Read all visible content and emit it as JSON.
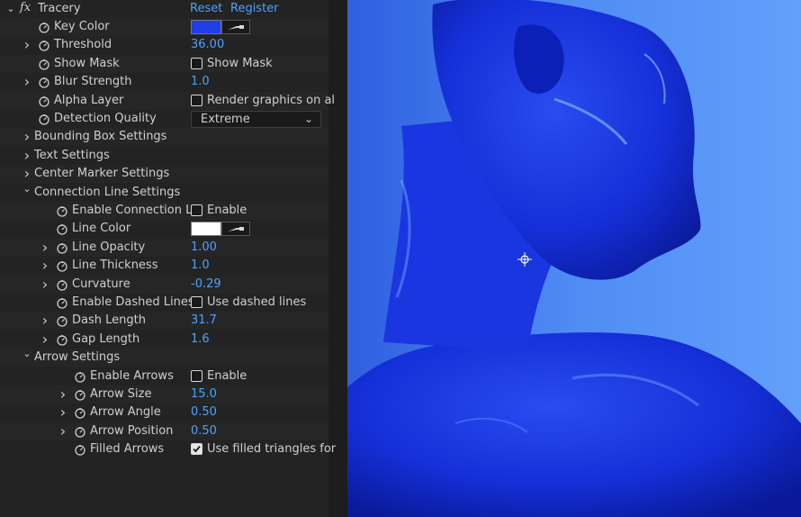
{
  "effect": {
    "name": "Tracery",
    "fx_label": "fx",
    "reset_label": "Reset",
    "register_label": "Register"
  },
  "rows": [
    {
      "label": "Key Color",
      "level": 1,
      "chevron": false,
      "stopwatch": true,
      "control": "color",
      "color": "#1e3ee6"
    },
    {
      "label": "Threshold",
      "level": 1,
      "chevron": true,
      "stopwatch": true,
      "control": "value",
      "value": "36.00"
    },
    {
      "label": "Show Mask",
      "level": 1,
      "chevron": false,
      "stopwatch": true,
      "control": "checkbox",
      "checked": false,
      "check_label": "Show Mask"
    },
    {
      "label": "Blur Strength",
      "level": 1,
      "chevron": true,
      "stopwatch": true,
      "control": "value",
      "value": "1.0"
    },
    {
      "label": "Alpha Layer",
      "level": 1,
      "chevron": false,
      "stopwatch": true,
      "control": "checkbox",
      "checked": false,
      "check_label": "Render graphics on al"
    },
    {
      "label": "Detection Quality",
      "level": 1,
      "chevron": false,
      "stopwatch": true,
      "control": "select",
      "value": "Extreme"
    },
    {
      "label": "Bounding Box Settings",
      "level": 0,
      "chevron": true,
      "stopwatch": false,
      "control": "none"
    },
    {
      "label": "Text Settings",
      "level": 0,
      "chevron": true,
      "stopwatch": false,
      "control": "none"
    },
    {
      "label": "Center Marker Settings",
      "level": 0,
      "chevron": true,
      "stopwatch": false,
      "control": "none"
    },
    {
      "label": "Connection Line Settings",
      "level": 0,
      "chevron": "open",
      "stopwatch": false,
      "control": "none"
    },
    {
      "label": "Enable Connection Li",
      "level": 2,
      "chevron": false,
      "stopwatch": true,
      "control": "checkbox",
      "checked": false,
      "check_label": "Enable"
    },
    {
      "label": "Line Color",
      "level": 2,
      "chevron": false,
      "stopwatch": true,
      "control": "color",
      "color": "#ffffff"
    },
    {
      "label": "Line Opacity",
      "level": 2,
      "chevron": true,
      "stopwatch": true,
      "control": "value",
      "value": "1.00"
    },
    {
      "label": "Line Thickness",
      "level": 2,
      "chevron": true,
      "stopwatch": true,
      "control": "value",
      "value": "1.0"
    },
    {
      "label": "Curvature",
      "level": 2,
      "chevron": true,
      "stopwatch": true,
      "control": "value",
      "value": "-0.29"
    },
    {
      "label": "Enable Dashed Lines",
      "level": 2,
      "chevron": false,
      "stopwatch": true,
      "control": "checkbox",
      "checked": false,
      "check_label": "Use dashed lines"
    },
    {
      "label": "Dash Length",
      "level": 2,
      "chevron": true,
      "stopwatch": true,
      "control": "value",
      "value": "31.7"
    },
    {
      "label": "Gap Length",
      "level": 2,
      "chevron": true,
      "stopwatch": true,
      "control": "value",
      "value": "1.6"
    },
    {
      "label": "Arrow Settings",
      "level": 1,
      "chevron": "open",
      "stopwatch": false,
      "control": "none"
    },
    {
      "label": "Enable Arrows",
      "level": 3,
      "chevron": false,
      "stopwatch": true,
      "control": "checkbox",
      "checked": false,
      "check_label": "Enable"
    },
    {
      "label": "Arrow Size",
      "level": 3,
      "chevron": true,
      "stopwatch": true,
      "control": "value",
      "value": "15.0"
    },
    {
      "label": "Arrow Angle",
      "level": 3,
      "chevron": true,
      "stopwatch": true,
      "control": "value",
      "value": "0.50"
    },
    {
      "label": "Arrow Position",
      "level": 3,
      "chevron": true,
      "stopwatch": true,
      "control": "value",
      "value": "0.50"
    },
    {
      "label": "Filled Arrows",
      "level": 3,
      "chevron": false,
      "stopwatch": true,
      "control": "checkbox",
      "checked": true,
      "check_label": "Use filled triangles for"
    }
  ],
  "colors": {
    "panel_bg": "#232323",
    "value_blue": "#4aa3ff",
    "preview_bg": "#4e8af2",
    "figure_blue": "#0f2cc8"
  },
  "preview": {
    "description_icon": "anchor-point-icon"
  }
}
